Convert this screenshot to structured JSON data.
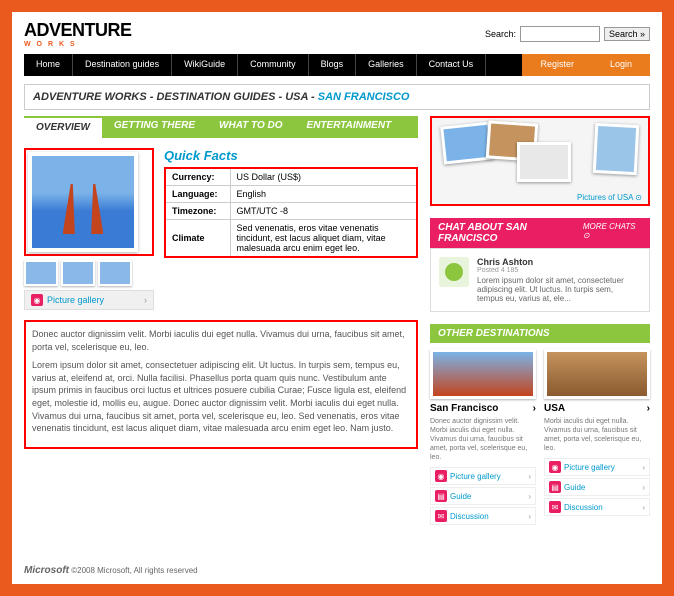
{
  "logo": {
    "main": "ADVENTURE",
    "sub": "W O R K S"
  },
  "search": {
    "label": "Search:",
    "placeholder": "",
    "button": "Search »"
  },
  "nav": {
    "items": [
      "Home",
      "Destination guides",
      "WikiGuide",
      "Community",
      "Blogs",
      "Galleries",
      "Contact Us"
    ],
    "right": [
      "Register",
      "Login"
    ]
  },
  "breadcrumb": {
    "prefix": "ADVENTURE WORKS - DESTINATION GUIDES - USA - ",
    "current": "SAN FRANCISCO"
  },
  "tabs": [
    "OVERVIEW",
    "GETTING THERE",
    "WHAT TO DO",
    "ENTERTAINMENT"
  ],
  "facts": {
    "title": "Quick Facts",
    "rows": [
      {
        "k": "Currency:",
        "v": "US Dollar (US$)"
      },
      {
        "k": "Language:",
        "v": "English"
      },
      {
        "k": "Timezone:",
        "v": "GMT/UTC -8"
      },
      {
        "k": "Climate",
        "v": "Sed venenatis, eros vitae venenatis tincidunt, est lacus aliquet diam, vitae malesuada arcu enim eget leo."
      }
    ]
  },
  "gallery_link": "Picture gallery",
  "description": {
    "p1": "Donec auctor dignissim velit. Morbi iaculis dui eget nulla. Vivamus dui urna, faucibus sit amet, porta vel, scelerisque eu, leo.",
    "p2": "Lorem ipsum dolor sit amet, consectetuer adipiscing elit. Ut luctus. In turpis sem, tempus eu, varius at, eleifend at, orci. Nulla facilisi. Phasellus porta quam quis nunc. Vestibulum ante ipsum primis in faucibus orci luctus et ultrices posuere cubilia Curae; Fusce ligula est, eleifend eget, molestie id, mollis eu, augue. Donec auctor dignissim velit. Morbi iaculis dui eget nulla. Vivamus dui urna, faucibus sit amet, porta vel, scelerisque eu, leo. Sed venenatis, eros vitae venenatis tincidunt, est lacus aliquet diam, vitae malesuada arcu enim eget leo. Nam justo."
  },
  "collage": {
    "caption": "Pictures of USA ⊙"
  },
  "chat": {
    "title": "CHAT ABOUT SAN FRANCISCO",
    "more": "MORE CHATS ⊙",
    "name": "Chris Ashton",
    "meta": "Posted 4 185",
    "text": "Lorem ipsum dolor sit amet, consectetuer adipiscing elit. Ut luctus. In turpis sem, tempus eu, varius at, ele..."
  },
  "other": {
    "title": "OTHER DESTINATIONS",
    "cards": [
      {
        "title": "San Francisco",
        "desc": "Donec auctor dignissim velit. Morbi iaculis dui eget nulla. Vivamus dui urna, faucibus sit amet, porta vel, scelerisque eu, leo."
      },
      {
        "title": "USA",
        "desc": "Morbi iaculis dui eget nulla. Vivamus dui urna, faucibus sit amet, porta vel, scelerisque eu, leo."
      }
    ],
    "links": [
      "Picture gallery",
      "Guide",
      "Discussion"
    ]
  },
  "footer": {
    "brand": "Microsoft",
    "copy": " ©2008 Microsoft, All rights reserved"
  }
}
